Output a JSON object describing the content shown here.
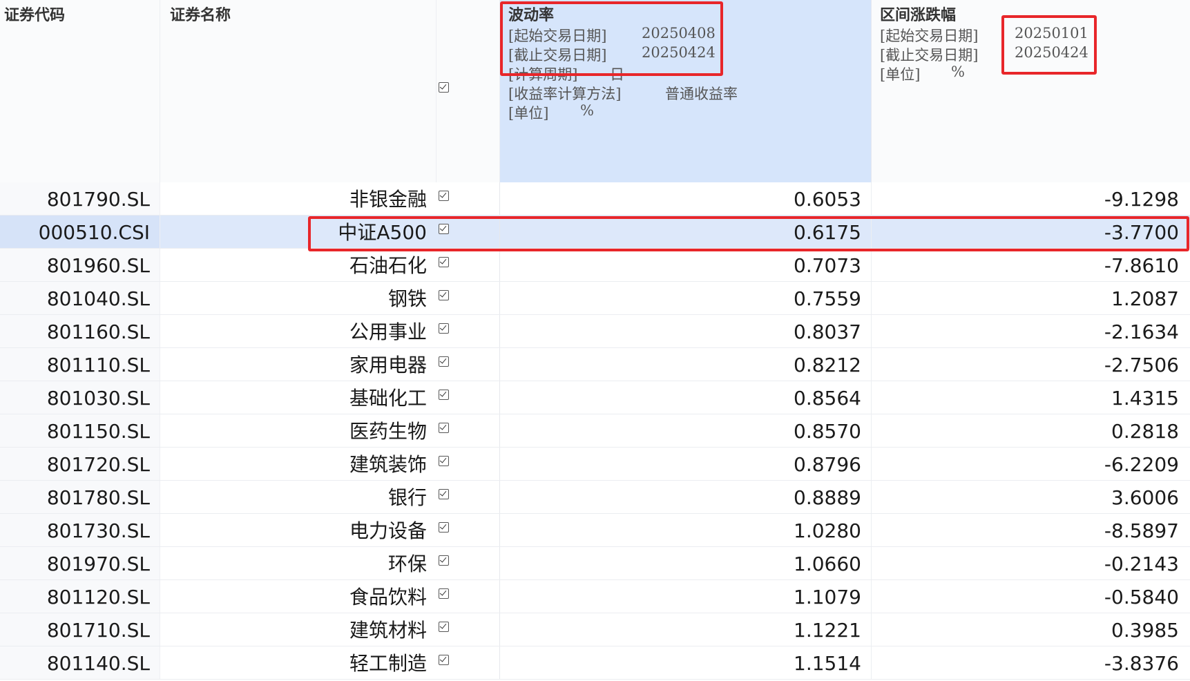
{
  "header": {
    "code_label": "证券代码",
    "name_label": "证券名称",
    "volatility": {
      "title": "波动率",
      "params": [
        {
          "label": "[起始交易日期]",
          "value": "20250408"
        },
        {
          "label": "[截止交易日期]",
          "value": "20250424"
        },
        {
          "label": "[计算周期]",
          "value": "日"
        },
        {
          "label": "[收益率计算方法]",
          "value": "普通收益率"
        },
        {
          "label": "[单位]",
          "value": "%"
        }
      ]
    },
    "range_change": {
      "title": "区间涨跌幅",
      "params": [
        {
          "label": "[起始交易日期]",
          "value": "20250101"
        },
        {
          "label": "[截止交易日期]",
          "value": "20250424"
        },
        {
          "label": "[单位]",
          "value": "%"
        }
      ]
    }
  },
  "rows": [
    {
      "code": "801790.SL",
      "name": "非银金融",
      "volatility": "0.6053",
      "change": "-9.1298"
    },
    {
      "code": "000510.CSI",
      "name": "中证A500",
      "volatility": "0.6175",
      "change": "-3.7700",
      "highlighted": true
    },
    {
      "code": "801960.SL",
      "name": "石油石化",
      "volatility": "0.7073",
      "change": "-7.8610"
    },
    {
      "code": "801040.SL",
      "name": "钢铁",
      "volatility": "0.7559",
      "change": "1.2087"
    },
    {
      "code": "801160.SL",
      "name": "公用事业",
      "volatility": "0.8037",
      "change": "-2.1634"
    },
    {
      "code": "801110.SL",
      "name": "家用电器",
      "volatility": "0.8212",
      "change": "-2.7506"
    },
    {
      "code": "801030.SL",
      "name": "基础化工",
      "volatility": "0.8564",
      "change": "1.4315"
    },
    {
      "code": "801150.SL",
      "name": "医药生物",
      "volatility": "0.8570",
      "change": "0.2818"
    },
    {
      "code": "801720.SL",
      "name": "建筑装饰",
      "volatility": "0.8796",
      "change": "-6.2209"
    },
    {
      "code": "801780.SL",
      "name": "银行",
      "volatility": "0.8889",
      "change": "3.6006"
    },
    {
      "code": "801730.SL",
      "name": "电力设备",
      "volatility": "1.0280",
      "change": "-8.5897"
    },
    {
      "code": "801970.SL",
      "name": "环保",
      "volatility": "1.0660",
      "change": "-0.2143"
    },
    {
      "code": "801120.SL",
      "name": "食品饮料",
      "volatility": "1.1079",
      "change": "-0.5840"
    },
    {
      "code": "801710.SL",
      "name": "建筑材料",
      "volatility": "1.1221",
      "change": "0.3985"
    },
    {
      "code": "801140.SL",
      "name": "轻工制造",
      "volatility": "1.1514",
      "change": "-3.8376"
    }
  ],
  "colors": {
    "highlight_row": "#dde8fa",
    "volatility_header": "#d6e5fb",
    "annotation_box": "#e8262a"
  }
}
